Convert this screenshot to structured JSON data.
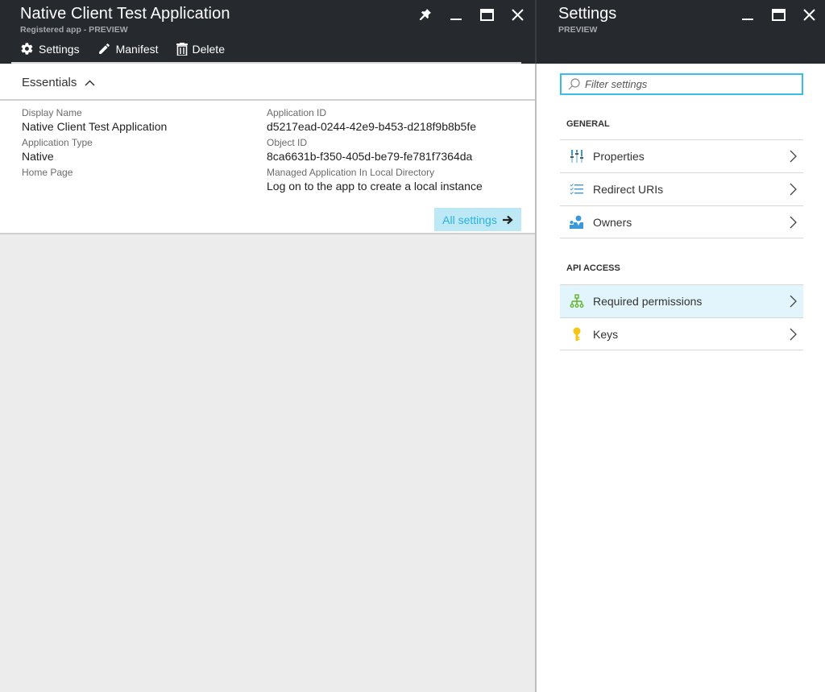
{
  "left_blade": {
    "title": "Native Client Test Application",
    "subtitle": "Registered app - PREVIEW",
    "commands": [
      {
        "label": "Settings",
        "icon": "gear-icon"
      },
      {
        "label": "Manifest",
        "icon": "pencil-icon"
      },
      {
        "label": "Delete",
        "icon": "trash-icon"
      }
    ],
    "window_controls": [
      "pin-icon",
      "minimize-icon",
      "maximize-icon",
      "close-icon"
    ],
    "essentials": {
      "heading": "Essentials",
      "left_fields": [
        {
          "label": "Display Name",
          "value": "Native Client Test Application"
        },
        {
          "label": "Application Type",
          "value": "Native"
        },
        {
          "label": "Home Page",
          "value": ""
        }
      ],
      "right_fields": [
        {
          "label": "Application ID",
          "value": "d5217ead-0244-42e9-b453-d218f9b8b5fe"
        },
        {
          "label": "Object ID",
          "value": "8ca6631b-f350-405d-be79-fe781f7364da"
        },
        {
          "label": "Managed Application In Local Directory",
          "value": "Log on to the app to create a local instance"
        }
      ],
      "all_settings_label": "All settings"
    }
  },
  "right_blade": {
    "title": "Settings",
    "subtitle": "PREVIEW",
    "window_controls": [
      "minimize-icon",
      "maximize-icon",
      "close-icon"
    ],
    "filter": {
      "placeholder": "Filter settings",
      "value": ""
    },
    "sections": [
      {
        "label": "GENERAL",
        "items": [
          {
            "label": "Properties",
            "icon": "properties-icon"
          },
          {
            "label": "Redirect URIs",
            "icon": "list-icon"
          },
          {
            "label": "Owners",
            "icon": "owners-icon"
          }
        ]
      },
      {
        "label": "API ACCESS",
        "items": [
          {
            "label": "Required permissions",
            "icon": "hierarchy-icon",
            "selected": true
          },
          {
            "label": "Keys",
            "icon": "key-icon"
          }
        ]
      }
    ]
  },
  "colors": {
    "header_bg": "#262a2f",
    "accent": "#38bfe9",
    "selected_bg": "#e3f5fc",
    "all_settings_bg": "#bde9f6"
  }
}
